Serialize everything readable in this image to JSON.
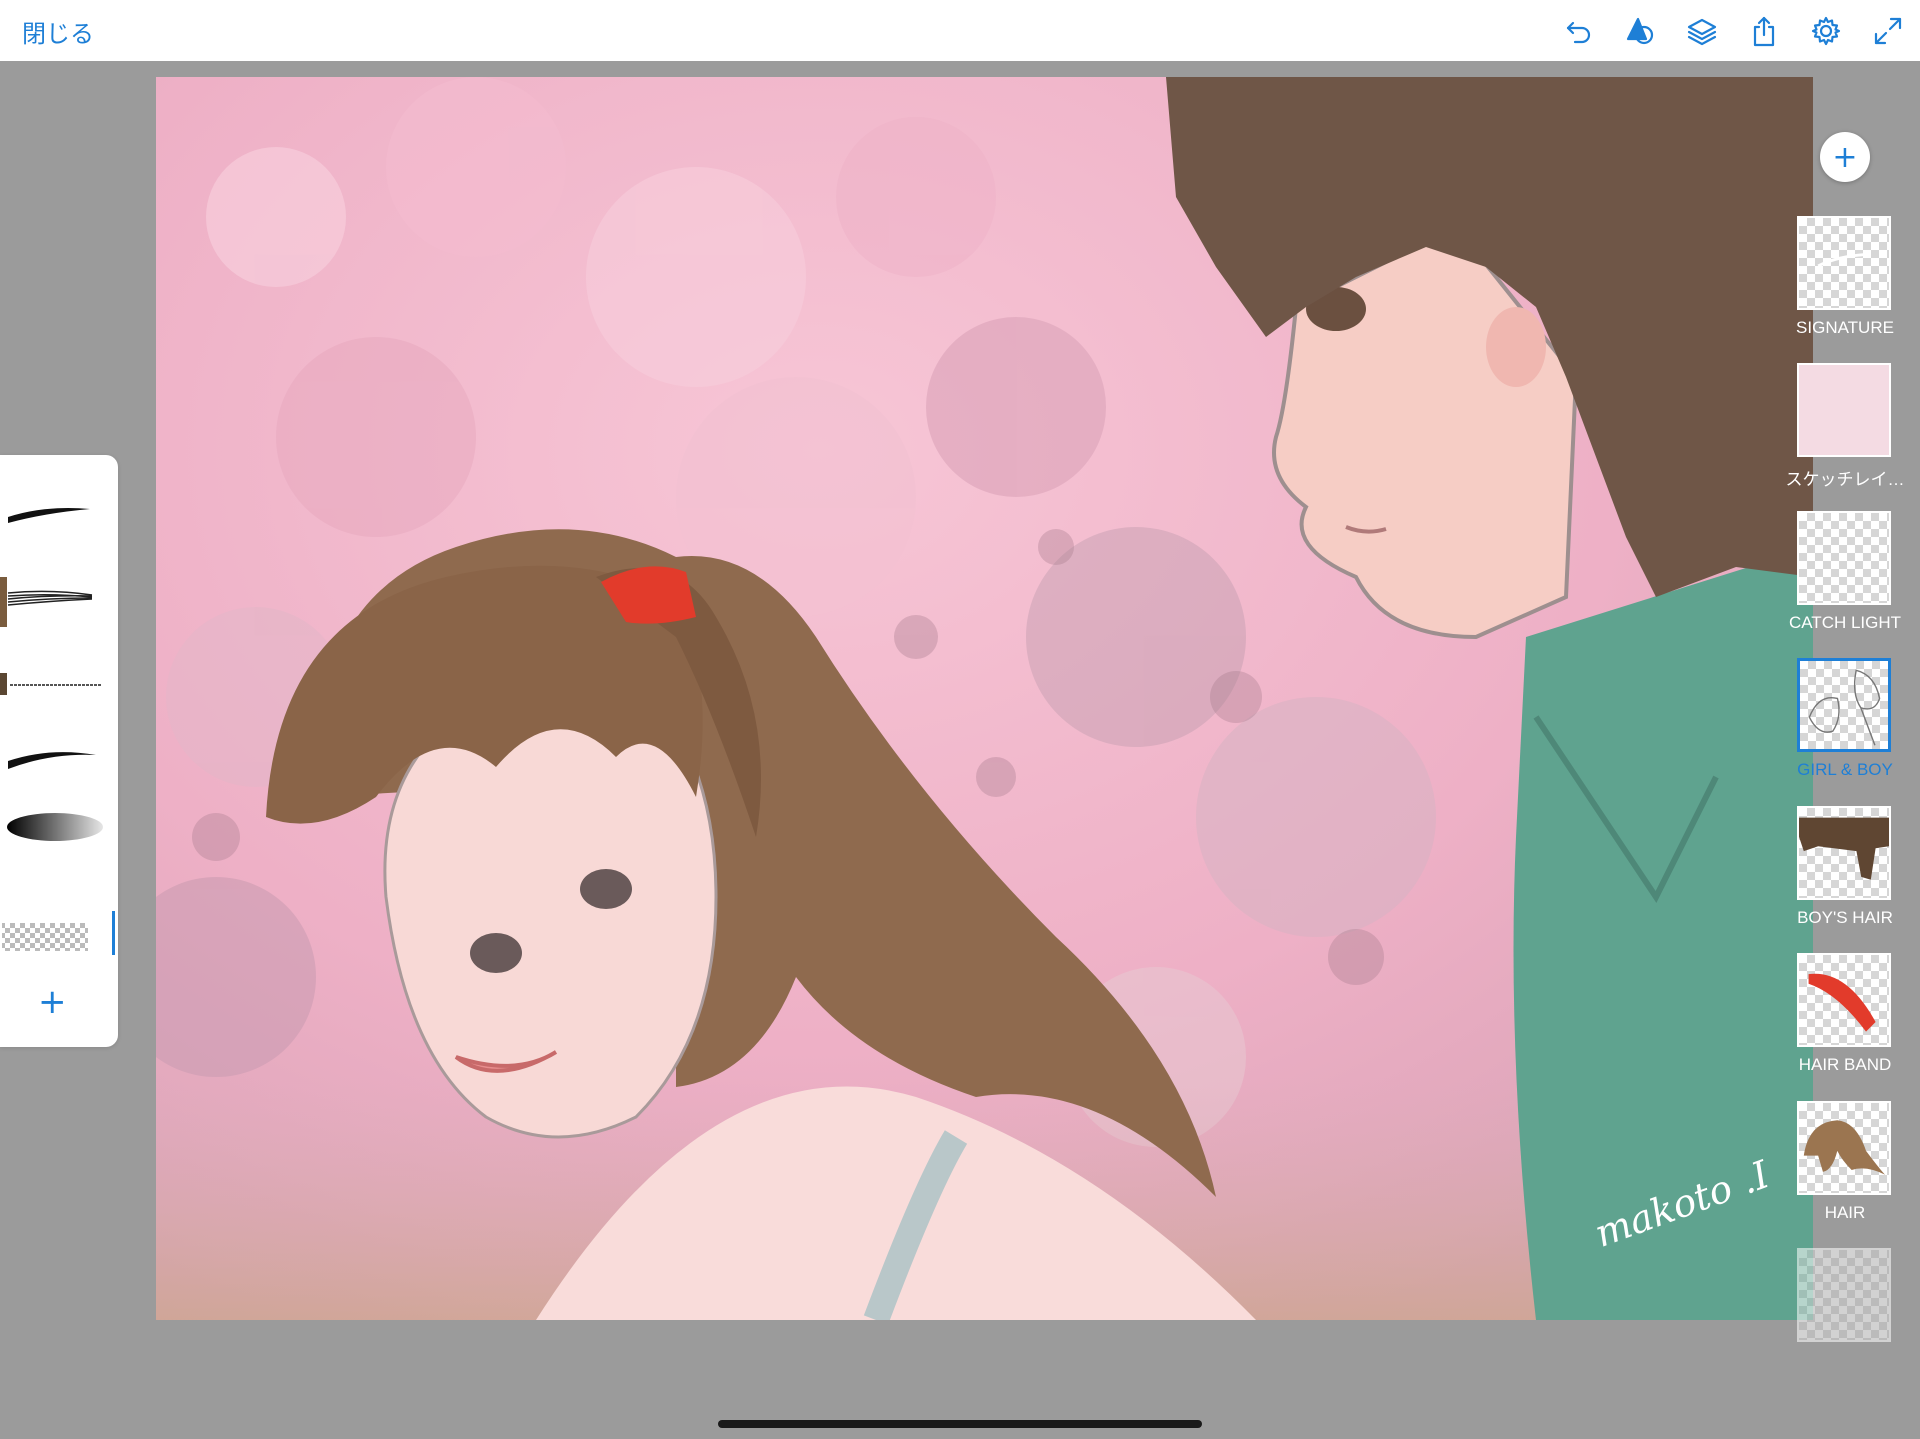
{
  "toolbar": {
    "close_label": "閉じる",
    "icons": [
      "undo-icon",
      "shape-tool-icon",
      "layers-icon",
      "share-icon",
      "settings-icon",
      "fullscreen-icon"
    ],
    "accent_color": "#1e7fd6"
  },
  "canvas": {
    "signature_text": "makoto .I"
  },
  "brushes": {
    "items": [
      {
        "name": "ink-brush-1"
      },
      {
        "name": "hair-brush",
        "color": "#7a5c3e"
      },
      {
        "name": "pencil-brush",
        "color": "#5a4632"
      },
      {
        "name": "ink-brush-2"
      },
      {
        "name": "soft-airbrush"
      },
      {
        "name": "eraser-pattern-brush",
        "selected": true
      }
    ],
    "add_label": "+"
  },
  "layers": {
    "add_label": "+",
    "items": [
      {
        "label": "SIGNATURE",
        "selected": false
      },
      {
        "label": "スケッチレイ…",
        "selected": false
      },
      {
        "label": "CATCH LIGHT",
        "selected": false
      },
      {
        "label": "GIRL & BOY",
        "selected": true
      },
      {
        "label": "BOY'S HAIR",
        "selected": false
      },
      {
        "label": "HAIR BAND",
        "selected": false
      },
      {
        "label": "HAIR",
        "selected": false
      },
      {
        "label": "",
        "selected": false
      }
    ]
  }
}
